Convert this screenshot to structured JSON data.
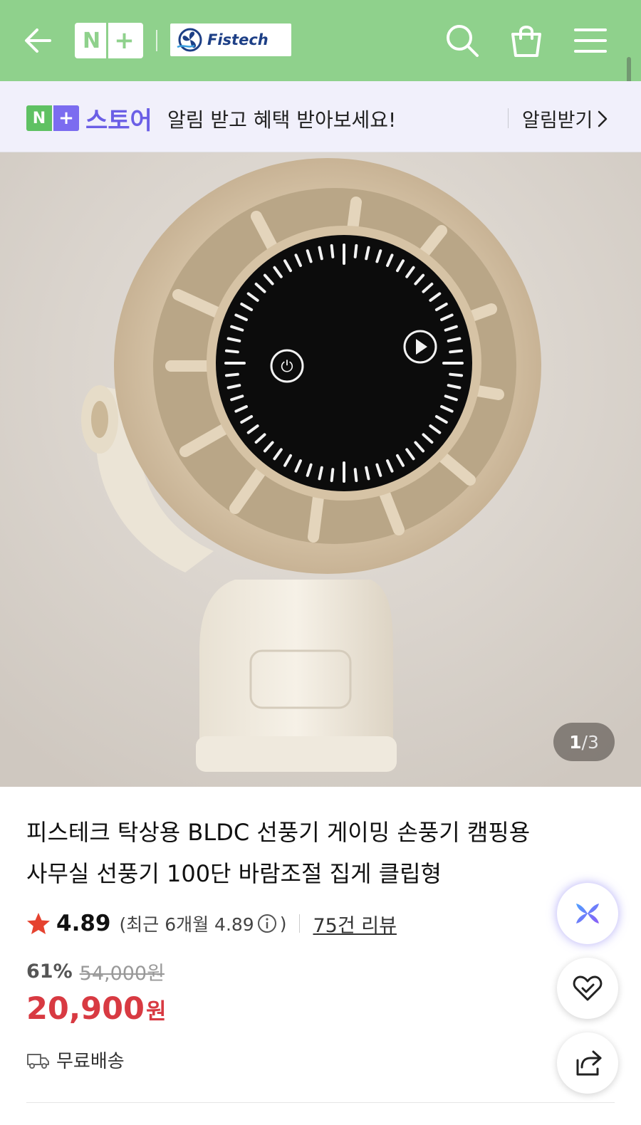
{
  "header": {
    "back_icon": "arrow-left-icon",
    "nplus_logo": {
      "n": "N",
      "plus": "+"
    },
    "brand_logo_text": "Fistech",
    "icons": [
      "search-icon",
      "shopping-bag-icon",
      "hamburger-menu-icon"
    ],
    "bg_color": "#8fd18c"
  },
  "notice": {
    "store_badge": {
      "n": "N",
      "plus": "+"
    },
    "store_word": "스토어",
    "message": "알림 받고 혜택 받아보세요!",
    "cta_label": "알림받기"
  },
  "gallery": {
    "current": "1",
    "total": "/3"
  },
  "product": {
    "title_line1": "피스테크 탁상용 BLDC 선풍기 게이밍 손풍기 캠핑용",
    "title_line2": "사무실 선풍기 100단 바람조절 집게 클립형",
    "rating": "4.89",
    "recent_rating_label": "(최근 6개월 4.89",
    "recent_rating_close": ")",
    "review_count": "75건 리뷰",
    "discount_rate": "61%",
    "original_price": "54,000원",
    "sale_price": "20,900",
    "currency": "원",
    "shipping": "무료배송",
    "price_color": "#d83a42",
    "star_color": "#e5422f"
  },
  "floating_buttons": [
    "ai-assistant-icon",
    "heart-check-icon",
    "share-icon"
  ]
}
